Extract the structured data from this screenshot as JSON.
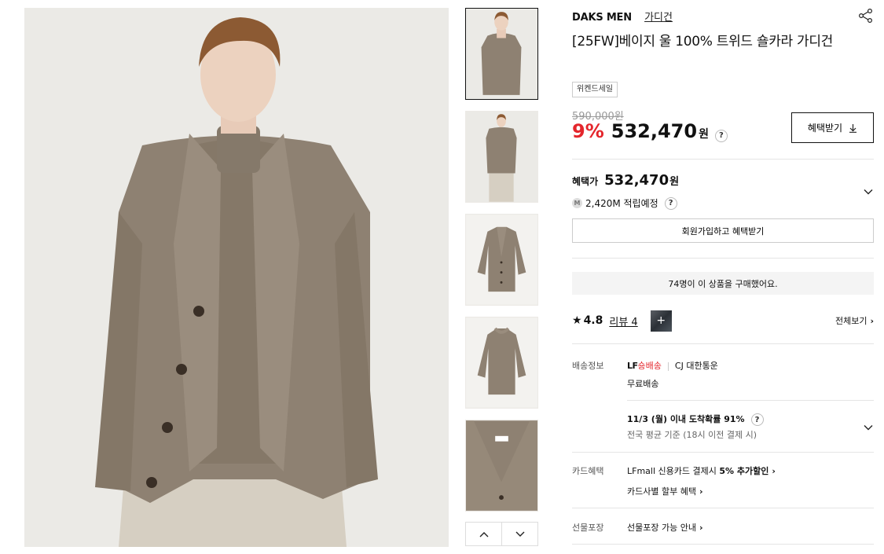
{
  "gallery": {
    "main_alt": "Model wearing beige wool tweed shawl collar cardigan",
    "thumbnails": [
      "model front",
      "model full body",
      "flat front",
      "flat back",
      "collar detail"
    ]
  },
  "product": {
    "brand": "DAKS MEN",
    "category": "가디건",
    "title": "[25FW]베이지 울 100% 트위드 숄카라 가디건",
    "tag": "위켄드세일",
    "original_price": "590,000원",
    "discount": "9%",
    "price": "532,470",
    "currency": "원",
    "benefit_button": "혜택받기"
  },
  "benefit": {
    "label": "혜택가",
    "price": "532,470",
    "currency": "원",
    "points_badge": "M",
    "points": "2,420M 적립예정",
    "join_button": "회원가입하고 혜택받기"
  },
  "purchase_notice": "74명이 이 상품을 구매했어요.",
  "review": {
    "star": "★",
    "rating": "4.8",
    "link": "리뷰 4",
    "view_all": "전체보기"
  },
  "shipping": {
    "label": "배송정보",
    "logo_text": "LF",
    "logo_suffix": "숑배송",
    "courier": "CJ 대한통운",
    "fee": "무료배송",
    "arrival": "11/3 (월) 이내 도착확률 91%",
    "arrival_note": "전국 평균 기준 (18시 이전 결제 시)"
  },
  "card": {
    "label": "카드혜택",
    "line1_prefix": "LFmall 신용카드 결제시 ",
    "line1_bold": "5% 추가할인",
    "line2": "카드사별 할부 혜택"
  },
  "gift": {
    "label": "선물포장",
    "text": "선물포장 가능 안내"
  },
  "colors": {
    "accent_red": "#e4262c",
    "cardigan": "#8e8172",
    "background": "#ecebe8"
  }
}
